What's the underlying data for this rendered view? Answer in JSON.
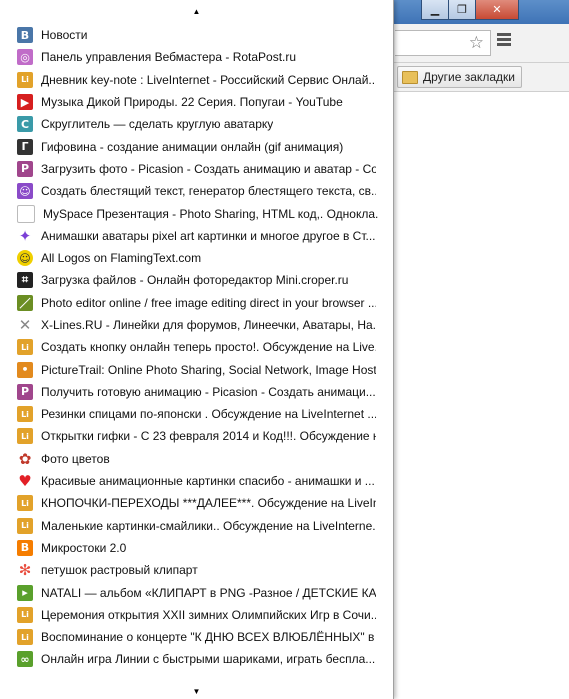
{
  "window": {
    "controls": [
      "minimize",
      "restore",
      "close"
    ]
  },
  "bookmarks_bar": {
    "other_bookmarks": "Другие закладки"
  },
  "menu": {
    "items": [
      {
        "label": "Новости",
        "icon": "vk-icon",
        "color": "#4a76a8"
      },
      {
        "label": "Панель управления Вебмастера - RotaPost.ru",
        "icon": "rotapost-icon",
        "color": "#c06cc8"
      },
      {
        "label": "Дневник key-note : LiveInternet - Российский Сервис Онлай...",
        "icon": "liveinternet-icon",
        "color": "#e2a22a"
      },
      {
        "label": "Музыка Дикой Природы. 22 Серия. Попугаи - YouTube",
        "icon": "youtube-icon",
        "color": "#d61f1f"
      },
      {
        "label": "Скруглитель — сделать круглую аватарку",
        "icon": "round-avatar-icon",
        "color": "#3a9aa8"
      },
      {
        "label": "Гифовина - создание анимации онлайн (gif анимация)",
        "icon": "gifovina-icon",
        "color": "#333333"
      },
      {
        "label": "Загрузить фото - Picasion - Создать анимацию и аватар - Со...",
        "icon": "picasion-icon",
        "color": "#a0468c"
      },
      {
        "label": "Создать блестящий текст, генератор блестящего текста, св...",
        "icon": "smiley-icon",
        "color": "#8a4bc8"
      },
      {
        "label": "MySpace Презентация - Photo Sharing, HTML код,. Однокла...",
        "icon": "page-icon",
        "color": "#bdbdbd"
      },
      {
        "label": "Анимашки аватары pixel art картинки и многое другое в Ст...",
        "icon": "butterfly-icon",
        "color": "#7b3fd6"
      },
      {
        "label": "All Logos on FlamingText.com",
        "icon": "flamingtext-icon",
        "color": "#f0d000"
      },
      {
        "label": "Загрузка файлов - Онлайн фоторедактор Mini.croper.ru",
        "icon": "croper-icon",
        "color": "#222222"
      },
      {
        "label": "Photo editor online / free image editing direct in your browser ...",
        "icon": "brush-icon",
        "color": "#6b8e23"
      },
      {
        "label": "X-Lines.RU - Линейки для форумов, Линеечки, Аватары, На...",
        "icon": "xlines-icon",
        "color": "#888888"
      },
      {
        "label": "Создать кнопку онлайн теперь просто!. Обсуждение на Live...",
        "icon": "liveinternet-icon",
        "color": "#e2a22a"
      },
      {
        "label": "PictureTrail: Online Photo Sharing, Social Network, Image Host...",
        "icon": "picturetrail-icon",
        "color": "#e28a1e"
      },
      {
        "label": "Получить готовую анимацию - Picasion - Создать анимаци...",
        "icon": "picasion-icon",
        "color": "#a0468c"
      },
      {
        "label": "Резинки спицами по-японски . Обсуждение на LiveInternet ...",
        "icon": "liveinternet-icon",
        "color": "#e2a22a"
      },
      {
        "label": "Открытки гифки - С 23 февраля 2014 и Код!!!. Обсуждение н...",
        "icon": "liveinternet-icon",
        "color": "#e2a22a"
      },
      {
        "label": "Фото цветов",
        "icon": "flower-icon",
        "color": "#c0392b"
      },
      {
        "label": "Красивые анимационные картинки спасибо - анимашки и ...",
        "icon": "heart-icon",
        "color": "#e21f26"
      },
      {
        "label": "КНОПОЧКИ-ПЕРЕХОДЫ ***ДАЛЕЕ***. Обсуждение на LiveInt...",
        "icon": "liveinternet-icon",
        "color": "#e2a22a"
      },
      {
        "label": "Маленькие картинки-смайлики.. Обсуждение на LiveInterne...",
        "icon": "liveinternet-icon",
        "color": "#e2a22a"
      },
      {
        "label": "Микростоки 2.0",
        "icon": "blogger-icon",
        "color": "#f57d00"
      },
      {
        "label": "петушок растровый клипарт",
        "icon": "pinwheel-icon",
        "color": "#e84c3d"
      },
      {
        "label": "NATALI — альбом «КЛИПАРТ в PNG -Разное / ДЕТСКИЕ КА...",
        "icon": "natali-icon",
        "color": "#5aa02c"
      },
      {
        "label": "Церемония открытия XXII зимних Олимпийских Игр в Сочи...",
        "icon": "liveinternet-icon",
        "color": "#e2a22a"
      },
      {
        "label": "Воспоминание о концерте \"К ДНЮ ВСЕХ ВЛЮБЛЁННЫХ\" в ...",
        "icon": "liveinternet-icon",
        "color": "#e2a22a"
      },
      {
        "label": "Онлайн игра Линии с быстрыми шариками, играть беспла...",
        "icon": "link-icon",
        "color": "#5aa02c"
      }
    ]
  }
}
